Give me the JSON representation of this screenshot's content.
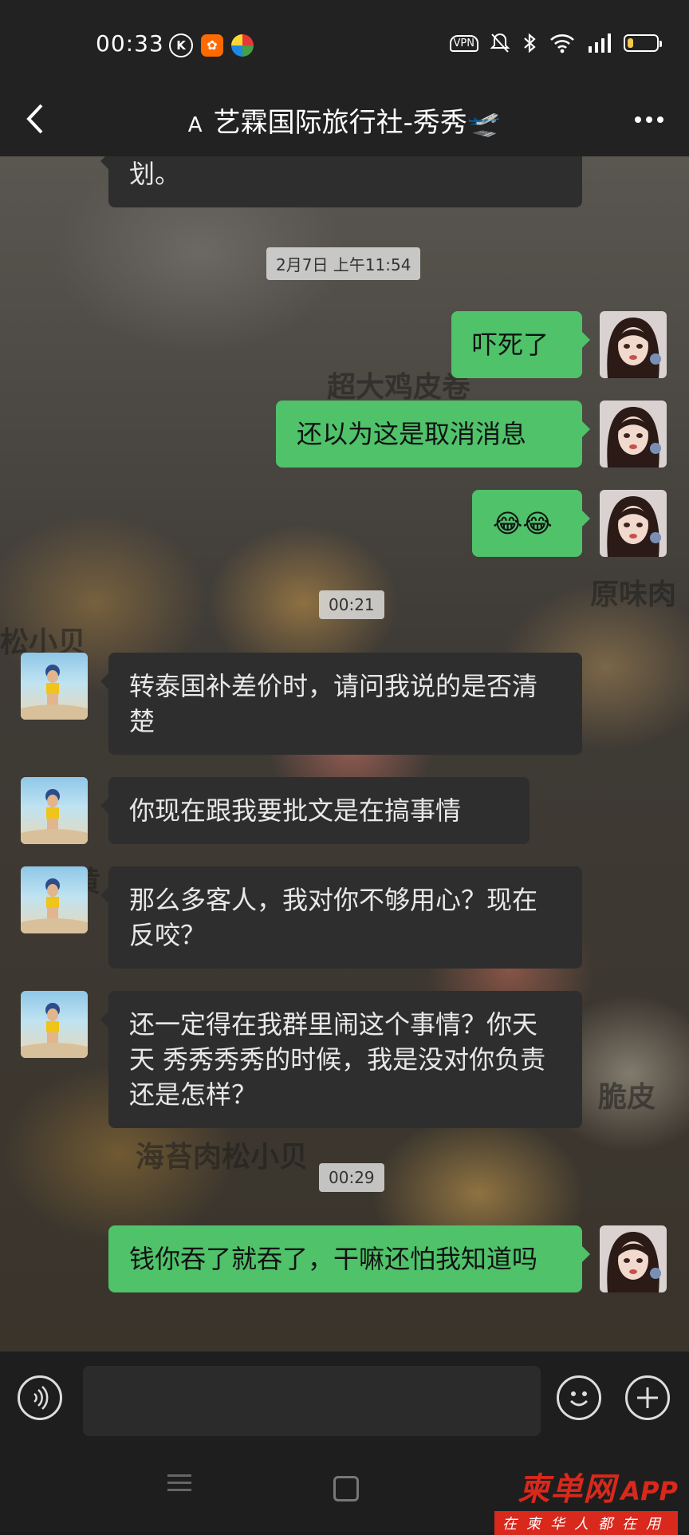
{
  "status_bar": {
    "time": "00:33",
    "vpn_label": "VPN",
    "battery_percent": 20,
    "icons": [
      "k-icon",
      "app-icon",
      "pinwheel-icon",
      "vpn-icon",
      "bell-off-icon",
      "bluetooth-icon",
      "wifi-icon",
      "signal-icon",
      "battery-icon"
    ]
  },
  "header": {
    "prefix": "A",
    "title": "艺霖国际旅行社-秀秀🛫"
  },
  "messages": [
    {
      "type": "text",
      "side": "in",
      "text": "划。",
      "partial": true
    },
    {
      "type": "time",
      "text": "2月7日 上午11:54"
    },
    {
      "type": "text",
      "side": "out",
      "text": "吓死了"
    },
    {
      "type": "text",
      "side": "out",
      "text": "还以为这是取消消息"
    },
    {
      "type": "text",
      "side": "out",
      "text": "😂😂"
    },
    {
      "type": "time",
      "text": "00:21"
    },
    {
      "type": "text",
      "side": "in",
      "text": "转泰国补差价时，请问我说的是否清楚"
    },
    {
      "type": "text",
      "side": "in",
      "text": "你现在跟我要批文是在搞事情"
    },
    {
      "type": "text",
      "side": "in",
      "text": "那么多客人，我对你不够用心？现在反咬？"
    },
    {
      "type": "text",
      "side": "in",
      "text": "还一定得在我群里闹这个事情？你天天 秀秀秀秀的时候，我是没对你负责还是怎样？"
    },
    {
      "type": "time",
      "text": "00:29"
    },
    {
      "type": "text",
      "side": "out",
      "text": "钱你吞了就吞了，干嘛还怕我知道吗"
    }
  ],
  "background_text": [
    "超大鸡皮卷",
    "原味肉",
    "松小贝",
    "脆皮",
    "海苔肉松小贝",
    "黄"
  ],
  "watermark": {
    "name": "柬单网",
    "app": "APP",
    "slogan": "在柬华人都在用"
  },
  "colors": {
    "outgoing": "#4fc26a",
    "incoming": "#2e2e2e",
    "watermark": "#d9281c"
  }
}
